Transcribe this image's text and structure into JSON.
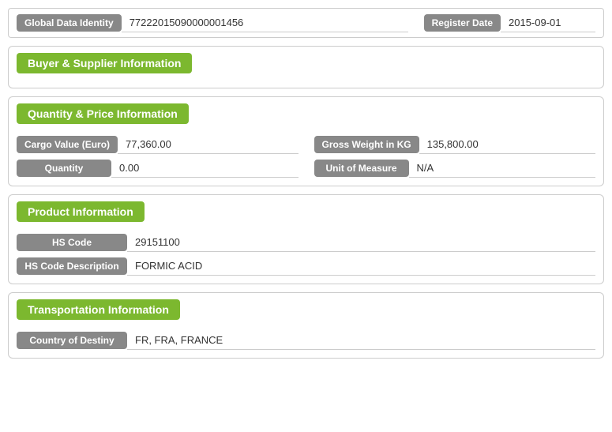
{
  "topBar": {
    "globalDataIdentityLabel": "Global Data Identity",
    "globalDataIdentityValue": "77222015090000001456",
    "registerDateLabel": "Register Date",
    "registerDateValue": "2015-09-01"
  },
  "sections": {
    "buyerSupplier": {
      "header": "Buyer & Supplier Information"
    },
    "quantityPrice": {
      "header": "Quantity & Price Information",
      "cargoValueLabel": "Cargo Value (Euro)",
      "cargoValueValue": "77,360.00",
      "grossWeightLabel": "Gross Weight in KG",
      "grossWeightValue": "135,800.00",
      "quantityLabel": "Quantity",
      "quantityValue": "0.00",
      "unitOfMeasureLabel": "Unit of Measure",
      "unitOfMeasureValue": "N/A"
    },
    "productInfo": {
      "header": "Product Information",
      "hsCodeLabel": "HS Code",
      "hsCodeValue": "29151100",
      "hsCodeDescLabel": "HS Code Description",
      "hsCodeDescValue": "FORMIC ACID"
    },
    "transportation": {
      "header": "Transportation Information",
      "countryDestinyLabel": "Country of Destiny",
      "countryDestinyValue": "FR, FRA, FRANCE"
    }
  }
}
